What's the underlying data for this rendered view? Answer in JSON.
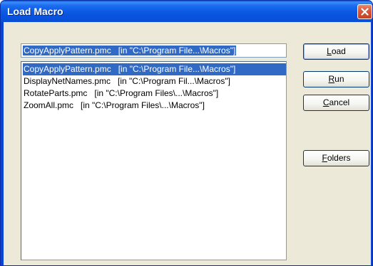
{
  "window": {
    "title": "Load Macro",
    "close_icon": "close-icon"
  },
  "path_input": {
    "value": "CopyApplyPattern.pmc   [in \"C:\\Program File...\\Macros\"]"
  },
  "macro_list": {
    "items": [
      {
        "label": "CopyApplyPattern.pmc   [in \"C:\\Program File...\\Macros\"]",
        "selected": true
      },
      {
        "label": "DisplayNetNames.pmc   [in \"C:\\Program Fil...\\Macros\"]",
        "selected": false
      },
      {
        "label": "RotateParts.pmc   [in \"C:\\Program Files\\...\\Macros\"]",
        "selected": false
      },
      {
        "label": "ZoomAll.pmc   [in \"C:\\Program Files\\...\\Macros\"]",
        "selected": false
      }
    ]
  },
  "buttons": {
    "load": {
      "accel": "L",
      "rest": "oad"
    },
    "run": {
      "accel": "R",
      "rest": "un"
    },
    "cancel": {
      "accel": "C",
      "rest": "ancel"
    },
    "folders": {
      "accel": "F",
      "rest": "olders"
    }
  },
  "colors": {
    "title_bar": "#0a58e3",
    "selection": "#316ac5",
    "dialog_face": "#ece9d8",
    "close_button": "#d9573a"
  }
}
